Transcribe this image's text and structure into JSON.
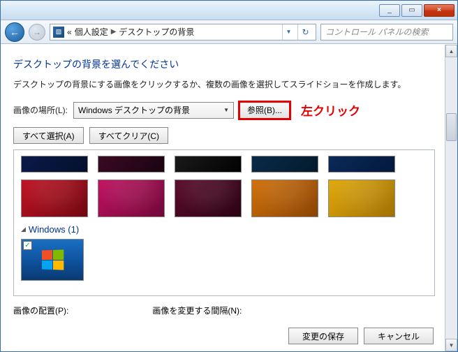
{
  "titlebar": {
    "min": "_",
    "max": "▭",
    "close": "×"
  },
  "nav": {
    "breadcrumb_root": "«",
    "breadcrumb_1": "個人設定",
    "breadcrumb_2": "デスクトップの背景",
    "search_placeholder": "コントロール パネルの検索"
  },
  "page": {
    "heading": "デスクトップの背景を選んでください",
    "subtext": "デスクトップの背景にする画像をクリックするか、複数の画像を選択してスライドショーを作成します。",
    "location_label": "画像の場所(L):",
    "location_value": "Windows デスクトップの背景",
    "browse_label": "参照(B)...",
    "annotation": "左クリック",
    "select_all": "すべて選択(A)",
    "clear_all": "すべてクリア(C)",
    "group_windows": "Windows (1)",
    "position_label": "画像の配置(P):",
    "interval_label": "画像を変更する間隔(N):"
  },
  "thumbs_top": [
    {
      "bg": "linear-gradient(135deg,#0a1a4a,#04102a)"
    },
    {
      "bg": "linear-gradient(135deg,#3a0a24,#1a0410)"
    },
    {
      "bg": "linear-gradient(135deg,#1a1a1a,#020202)"
    },
    {
      "bg": "linear-gradient(135deg,#0a2a4a,#041a2a)"
    },
    {
      "bg": "linear-gradient(135deg,#0a2a5a,#04183a)"
    }
  ],
  "thumbs_full": [
    {
      "bg": "linear-gradient(135deg,#c01020,#700812)"
    },
    {
      "bg": "linear-gradient(135deg,#c01060,#700838)"
    },
    {
      "bg": "linear-gradient(135deg,#5a0a2a,#2a0414)"
    },
    {
      "bg": "linear-gradient(135deg,#d07008,#8a4404)"
    },
    {
      "bg": "linear-gradient(135deg,#e0a808,#a07004)"
    }
  ],
  "footer": {
    "save": "変更の保存",
    "cancel": "キャンセル"
  }
}
